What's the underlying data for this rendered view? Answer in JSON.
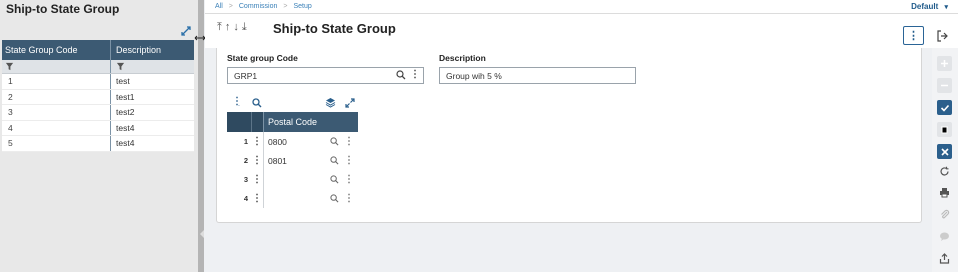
{
  "left_panel": {
    "title": "Ship-to State Group",
    "columns": [
      "State Group Code",
      "Description"
    ],
    "rows": [
      {
        "code": "1",
        "description": "test"
      },
      {
        "code": "2",
        "description": "test1"
      },
      {
        "code": "3",
        "description": "test2"
      },
      {
        "code": "4",
        "description": "test4"
      },
      {
        "code": "5",
        "description": "test4"
      }
    ]
  },
  "breadcrumb": [
    "All",
    "Commission",
    "Setup"
  ],
  "default_menu": "Default",
  "page_title": "Ship-to State Group",
  "form": {
    "state_group_code_label": "State group Code",
    "state_group_code_value": "GRP1",
    "description_label": "Description",
    "description_value": "Group wih 5 %"
  },
  "postal_grid": {
    "column": "Postal Code",
    "rows": [
      {
        "num": "1",
        "value": "0800"
      },
      {
        "num": "2",
        "value": "0801"
      },
      {
        "num": "3",
        "value": ""
      },
      {
        "num": "4",
        "value": ""
      }
    ]
  },
  "colors": {
    "header": "#3c5a73",
    "accent": "#2b5f8c",
    "link": "#3a80b8"
  }
}
